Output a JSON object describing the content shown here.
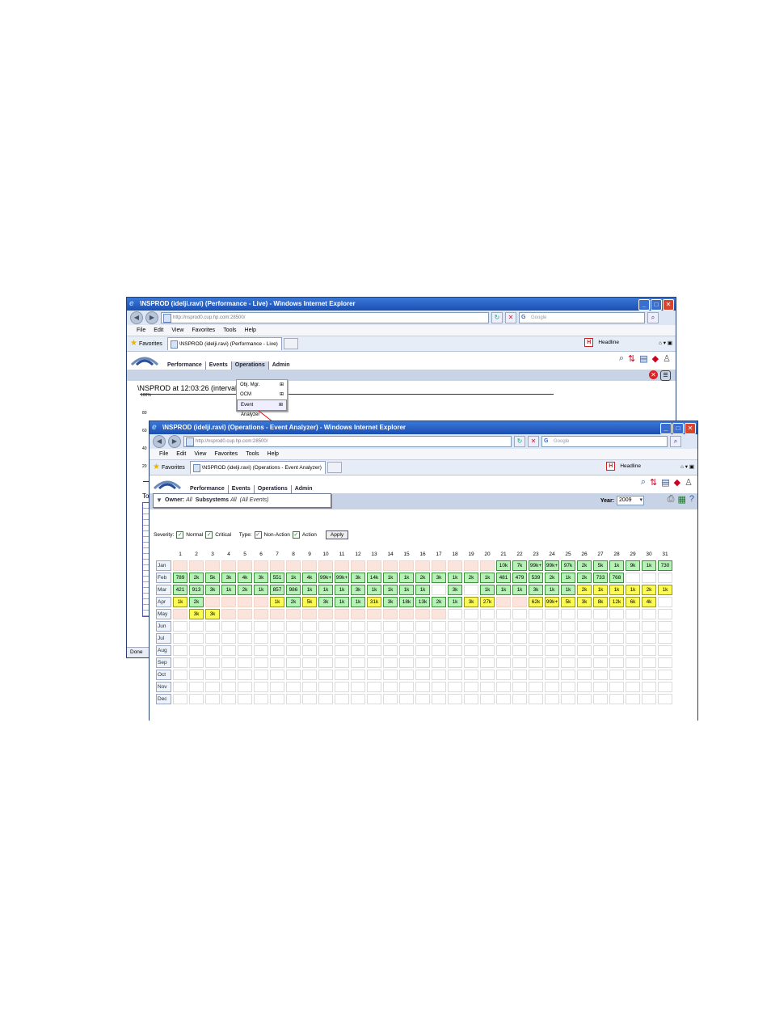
{
  "back": {
    "title": "\\NSPROD (idelji.ravi) (Performance - Live) - Windows Internet Explorer",
    "url": "http://nsprod0.cup.hp.com:28500/",
    "search_placeholder": "Google",
    "menu": [
      "File",
      "Edit",
      "View",
      "Favorites",
      "Tools",
      "Help"
    ],
    "favorites_label": "Favorites",
    "tab_label": "\\NSPROD (idelji.ravi) (Performance - Live)",
    "headline_label": "Headline",
    "nav": [
      "Performance",
      "Events",
      "Operations",
      "Admin"
    ],
    "dropdown": [
      "Obj. Mgr.",
      "OCM",
      "Event Analyzer"
    ],
    "heading": "\\NSPROD at 12:03:26 (interval : 5",
    "y_labels": [
      "100%",
      "80",
      "60",
      "40",
      "20"
    ],
    "side_text": "To",
    "status": "Done"
  },
  "front": {
    "title": "\\NSPROD (idelji.ravi) (Operations - Event Analyzer) - Windows Internet Explorer",
    "url": "http://nsprod0.cup.hp.com:28500/",
    "search_placeholder": "Google",
    "menu": [
      "File",
      "Edit",
      "View",
      "Favorites",
      "Tools",
      "Help"
    ],
    "favorites_label": "Favorites",
    "tab_label": "\\NSPROD (idelji.ravi) (Operations - Event Analyzer)",
    "headline_label": "Headline",
    "nav": [
      "Performance",
      "Events",
      "Operations",
      "Admin"
    ],
    "filter": {
      "owner_label": "Owner:",
      "owner_value": "All",
      "subsystems_label": "Subsystems",
      "subsystems_value": "All",
      "events_value": "(All Events)"
    },
    "year_label": "Year:",
    "year_value": "2009",
    "severity_label": "Severity:",
    "normal_label": "Normal",
    "critical_label": "Critical",
    "type_label": "Type:",
    "nonaction_label": "Non-Action",
    "action_label": "Action",
    "apply_label": "Apply",
    "days": [
      "1",
      "2",
      "3",
      "4",
      "5",
      "6",
      "7",
      "8",
      "9",
      "10",
      "11",
      "12",
      "13",
      "14",
      "15",
      "16",
      "17",
      "18",
      "19",
      "20",
      "21",
      "22",
      "23",
      "24",
      "25",
      "26",
      "27",
      "28",
      "29",
      "30",
      "31"
    ],
    "rows": [
      {
        "month": "Jan",
        "cells": [
          "p",
          "p",
          "p",
          "p",
          "p",
          "p",
          "p",
          "p",
          "p",
          "p",
          "p",
          "p",
          "p",
          "p",
          "p",
          "p",
          "p",
          "p",
          "p",
          "p",
          [
            "g",
            "10k"
          ],
          [
            "g",
            "7k"
          ],
          [
            "g",
            "99k+"
          ],
          [
            "g",
            "99k+"
          ],
          [
            "g",
            "97k"
          ],
          [
            "g",
            "2k"
          ],
          [
            "g",
            "5k"
          ],
          [
            "g",
            "1k"
          ],
          [
            "g",
            "9k"
          ],
          [
            "g",
            "1k"
          ],
          [
            "g",
            "730"
          ]
        ]
      },
      {
        "month": "Feb",
        "cells": [
          [
            "g",
            "789"
          ],
          [
            "g",
            "2k"
          ],
          [
            "g",
            "5k"
          ],
          [
            "g",
            "3k"
          ],
          [
            "g",
            "4k"
          ],
          [
            "g",
            "3k"
          ],
          [
            "g",
            "551"
          ],
          [
            "g",
            "1k"
          ],
          [
            "g",
            "4k"
          ],
          [
            "g",
            "99k+"
          ],
          [
            "g",
            "99k+"
          ],
          [
            "g",
            "3k"
          ],
          [
            "g",
            "14k"
          ],
          [
            "g",
            "1k"
          ],
          [
            "g",
            "1k"
          ],
          [
            "g",
            "2k"
          ],
          [
            "g",
            "3k"
          ],
          [
            "g",
            "1k"
          ],
          [
            "g",
            "2k"
          ],
          [
            "g",
            "1k"
          ],
          [
            "g",
            "481"
          ],
          [
            "g",
            "479"
          ],
          [
            "g",
            "539"
          ],
          [
            "g",
            "2k"
          ],
          [
            "g",
            "1k"
          ],
          [
            "g",
            "2k"
          ],
          [
            "g",
            "733"
          ],
          [
            "g",
            "768"
          ],
          "e",
          "e",
          "e"
        ]
      },
      {
        "month": "Mar",
        "cells": [
          [
            "g",
            "421"
          ],
          [
            "g",
            "913"
          ],
          [
            "g",
            "3k"
          ],
          [
            "g",
            "1k"
          ],
          [
            "g",
            "2k"
          ],
          [
            "g",
            "1k"
          ],
          [
            "g",
            "857"
          ],
          [
            "g",
            "986"
          ],
          [
            "g",
            "1k"
          ],
          [
            "g",
            "1k"
          ],
          [
            "g",
            "1k"
          ],
          [
            "g",
            "3k"
          ],
          [
            "g",
            "1k"
          ],
          [
            "g",
            "1k"
          ],
          [
            "g",
            "1k"
          ],
          [
            "g",
            "1k"
          ],
          "e",
          [
            "g",
            "3k"
          ],
          "e",
          [
            "g",
            "1k"
          ],
          [
            "g",
            "1k"
          ],
          [
            "g",
            "1k"
          ],
          [
            "g",
            "3k"
          ],
          [
            "g",
            "1k"
          ],
          [
            "g",
            "1k"
          ],
          [
            "y",
            "2k"
          ],
          [
            "y",
            "1k"
          ],
          [
            "y",
            "1k"
          ],
          [
            "y",
            "1k"
          ],
          [
            "y",
            "2k"
          ],
          [
            "y",
            "1k"
          ]
        ]
      },
      {
        "month": "Apr",
        "cells": [
          [
            "y",
            "1k"
          ],
          [
            "g",
            "2k"
          ],
          "p",
          "p",
          "p",
          "p",
          [
            "y",
            "1k"
          ],
          [
            "g",
            "2k"
          ],
          [
            "y",
            "5k"
          ],
          [
            "g",
            "3k"
          ],
          [
            "g",
            "1k"
          ],
          [
            "g",
            "1k"
          ],
          [
            "y",
            "31k"
          ],
          [
            "g",
            "3k"
          ],
          [
            "g",
            "18k"
          ],
          [
            "g",
            "13k"
          ],
          [
            "g",
            "2k"
          ],
          [
            "g",
            "1k"
          ],
          [
            "y",
            "3k"
          ],
          [
            "y",
            "27k"
          ],
          "p",
          "p",
          [
            "y",
            "62k"
          ],
          [
            "y",
            "99k+"
          ],
          [
            "y",
            "5k"
          ],
          [
            "y",
            "3k"
          ],
          [
            "y",
            "8k"
          ],
          [
            "y",
            "12k"
          ],
          [
            "y",
            "6k"
          ],
          [
            "y",
            "4k"
          ],
          "e"
        ]
      },
      {
        "month": "May",
        "cells": [
          "p",
          [
            "y",
            "3k"
          ],
          [
            "y",
            "3k"
          ],
          "p",
          "p",
          "p",
          "p",
          "p",
          "p",
          "p",
          "p",
          "p",
          "p",
          "p",
          "p",
          "p",
          "p",
          "e",
          "e",
          "e",
          "e",
          "e",
          "e",
          "e",
          "e",
          "e",
          "e",
          "e",
          "e",
          "e",
          "e"
        ]
      },
      {
        "month": "Jun",
        "cells": []
      },
      {
        "month": "Jul",
        "cells": []
      },
      {
        "month": "Aug",
        "cells": []
      },
      {
        "month": "Sep",
        "cells": []
      },
      {
        "month": "Oct",
        "cells": []
      },
      {
        "month": "Nov",
        "cells": []
      },
      {
        "month": "Dec",
        "cells": []
      }
    ]
  }
}
